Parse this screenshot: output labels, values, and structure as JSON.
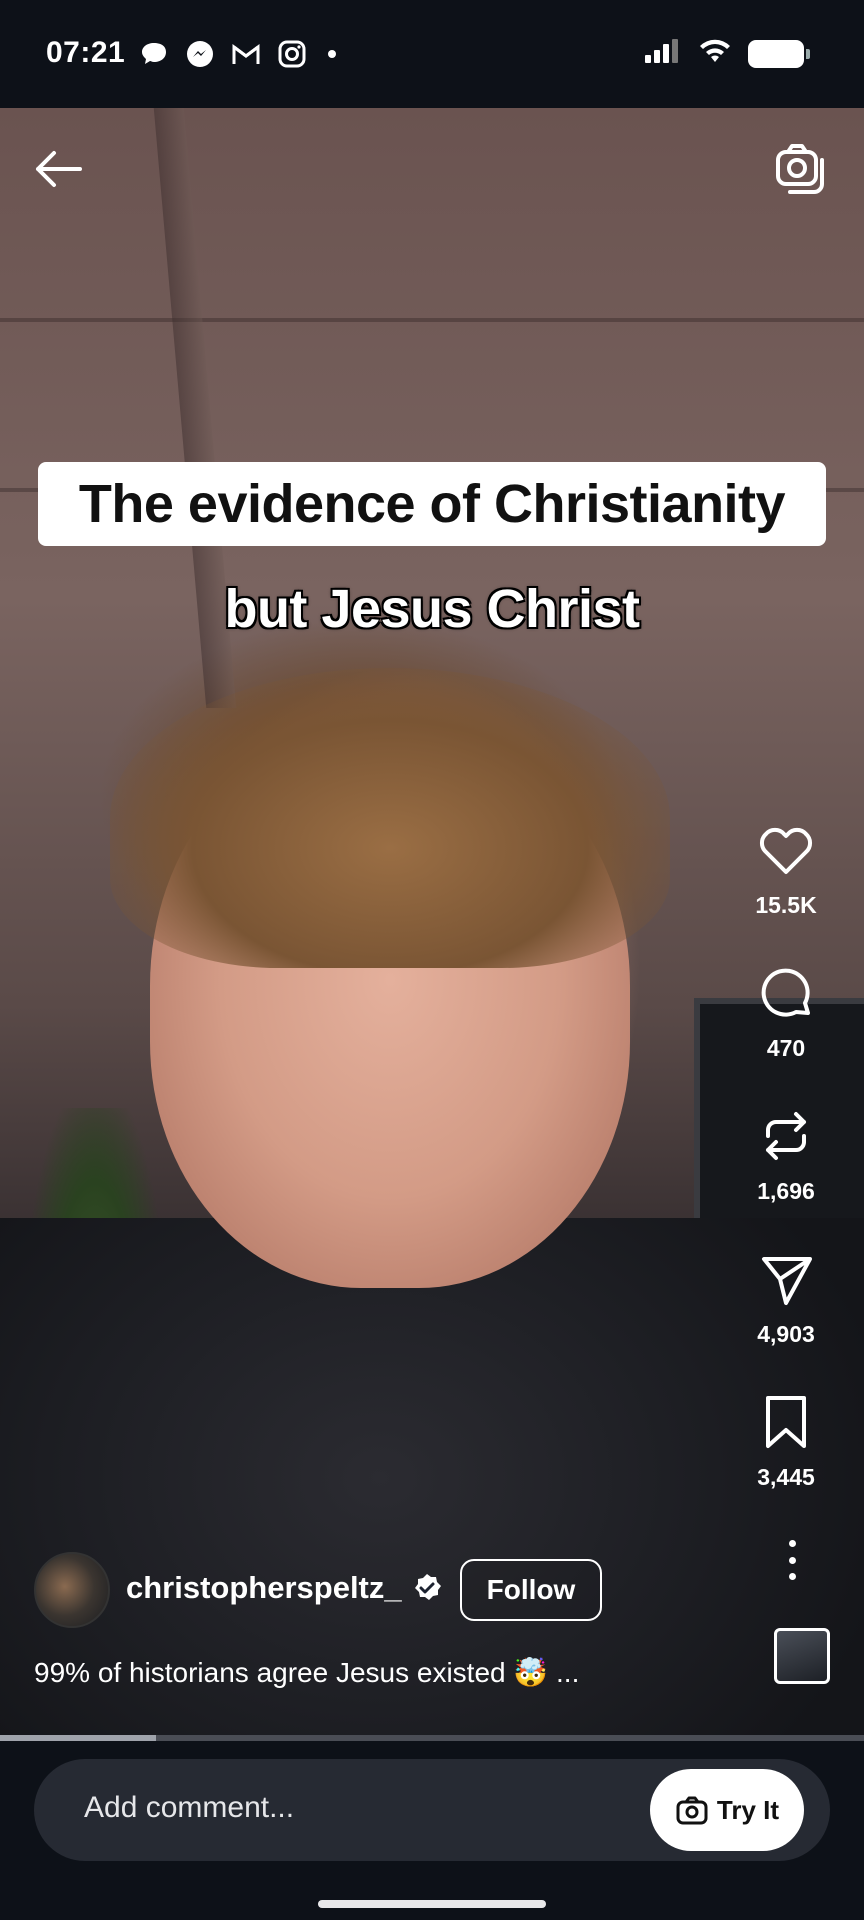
{
  "status_bar": {
    "time": "07:21"
  },
  "video": {
    "caption_box": "The evidence of Christianity",
    "caption_subtitle": "but Jesus Christ"
  },
  "actions": {
    "likes": "15.5K",
    "comments": "470",
    "reposts": "1,696",
    "shares": "4,903",
    "saves": "3,445"
  },
  "author": {
    "username": "christopherspeltz_",
    "follow_label": "Follow"
  },
  "description": "99% of historians agree Jesus existed 🤯 ...",
  "progress": {
    "played_fraction": 0.18
  },
  "comment_bar": {
    "placeholder": "Add comment...",
    "try_it_label": "Try It"
  }
}
